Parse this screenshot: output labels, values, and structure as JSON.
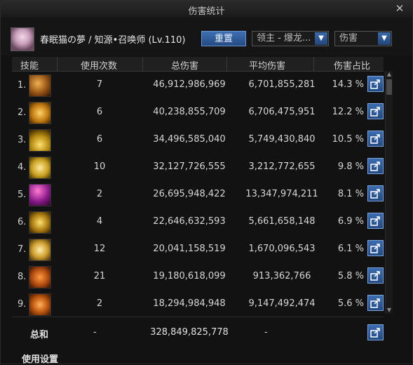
{
  "window": {
    "title": "伤害统计",
    "close_icon": "close-icon"
  },
  "header": {
    "character_name": "春眠猫の夢 / 知源•召唤师 (Lv.110)",
    "reset_label": "重置",
    "filter_value": "领主 - 爆龙...",
    "type_value": "伤害"
  },
  "columns": {
    "skill": "技能",
    "count": "使用次数",
    "total": "总伤害",
    "avg": "平均伤害",
    "share": "伤害占比"
  },
  "rows": [
    {
      "rank": "1.",
      "count": "7",
      "total": "46,912,986,969",
      "avg": "6,701,855,281",
      "pct": "14.3 %"
    },
    {
      "rank": "2.",
      "count": "6",
      "total": "40,238,855,709",
      "avg": "6,706,475,951",
      "pct": "12.2 %"
    },
    {
      "rank": "3.",
      "count": "6",
      "total": "34,496,585,040",
      "avg": "5,749,430,840",
      "pct": "10.5 %"
    },
    {
      "rank": "4.",
      "count": "10",
      "total": "32,127,726,555",
      "avg": "3,212,772,655",
      "pct": "9.8 %"
    },
    {
      "rank": "5.",
      "count": "2",
      "total": "26,695,948,422",
      "avg": "13,347,974,211",
      "pct": "8.1 %"
    },
    {
      "rank": "6.",
      "count": "4",
      "total": "22,646,632,593",
      "avg": "5,661,658,148",
      "pct": "6.9 %"
    },
    {
      "rank": "7.",
      "count": "12",
      "total": "20,041,158,519",
      "avg": "1,670,096,543",
      "pct": "6.1 %"
    },
    {
      "rank": "8.",
      "count": "21",
      "total": "19,180,618,099",
      "avg": "913,362,766",
      "pct": "5.8 %"
    },
    {
      "rank": "9.",
      "count": "2",
      "total": "18,294,984,948",
      "avg": "9,147,492,474",
      "pct": "5.6 %"
    }
  ],
  "total": {
    "label": "总和",
    "count": "-",
    "damage": "328,849,825,778",
    "avg": "-"
  },
  "footer": {
    "settings_label": "使用设置"
  },
  "colors": {
    "accent_blue": "#2f5e9e",
    "background": "#121212",
    "text": "#d6d6d6"
  }
}
